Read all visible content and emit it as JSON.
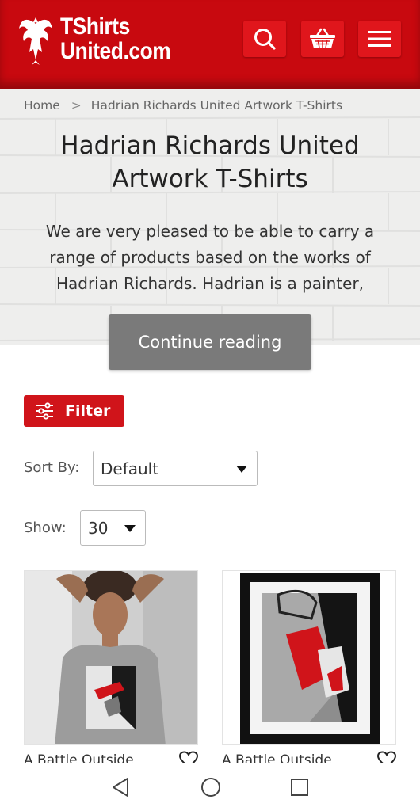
{
  "header": {
    "logo_line1": "TShirts",
    "logo_line2": "United.com",
    "brand_color": "#c8090f"
  },
  "breadcrumb": {
    "home": "Home",
    "current": "Hadrian Richards United Artwork T-Shirts"
  },
  "page": {
    "title_line1": "Hadrian Richards United",
    "title_line2": "Artwork T-Shirts",
    "intro": "We are very pleased to be able to carry a range of products based on the works of Hadrian Richards. Hadrian is a painter,",
    "continue_label": "Continue reading"
  },
  "controls": {
    "filter_label": "Filter",
    "sort_label": "Sort By:",
    "sort_value": "Default",
    "show_label": "Show:",
    "show_value": "30"
  },
  "products": [
    {
      "title": "A Battle Outside",
      "image": "model-wearing-tshirt"
    },
    {
      "title": "A Battle Outside",
      "image": "framed-print"
    }
  ],
  "icons": {
    "search": "search-icon",
    "basket": "basket-icon",
    "menu": "menu-icon",
    "filter": "sliders-icon",
    "wishlist": "heart-icon",
    "back": "back-triangle-icon",
    "home": "home-circle-icon",
    "recents": "recents-square-icon"
  }
}
